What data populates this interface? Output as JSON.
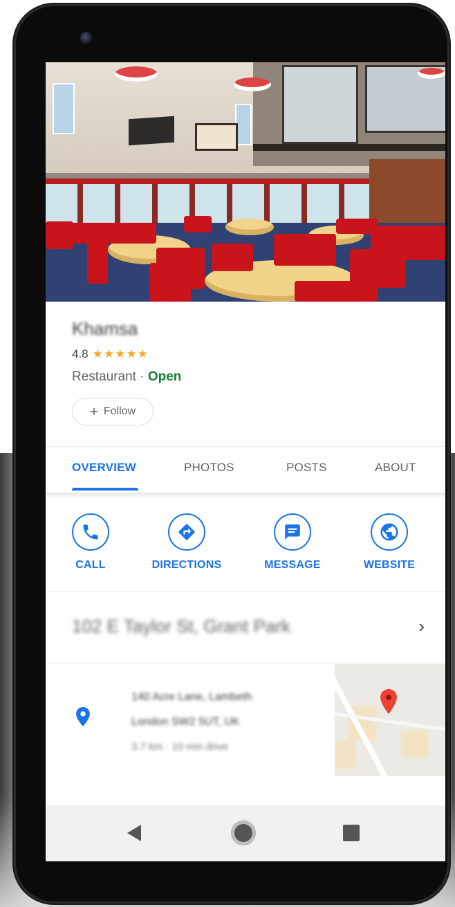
{
  "business": {
    "name": "Khamsa",
    "rating": "4.8",
    "stars": "★★★★★",
    "category": "Restaurant",
    "separator": "·",
    "status": "Open",
    "status_color": "#188038",
    "follow_label": "Follow",
    "follow_icon": "plus-icon"
  },
  "tabs": [
    {
      "label": "OVERVIEW",
      "active": true
    },
    {
      "label": "PHOTOS",
      "active": false
    },
    {
      "label": "POSTS",
      "active": false
    },
    {
      "label": "ABOUT",
      "active": false
    }
  ],
  "actions": [
    {
      "label": "CALL",
      "icon": "phone-icon"
    },
    {
      "label": "DIRECTIONS",
      "icon": "directions-icon"
    },
    {
      "label": "MESSAGE",
      "icon": "message-icon"
    },
    {
      "label": "WEBSITE",
      "icon": "globe-icon"
    }
  ],
  "address": {
    "text": "102 E Taylor St, Grant Park",
    "chevron": "›"
  },
  "location": {
    "line1": "140 Acre Lane, Lambeth",
    "line2": "London SW2 5UT, UK",
    "line3": "3.7 km · 10 min drive",
    "icon": "location-pin-icon"
  },
  "colors": {
    "accent": "#1a73e8",
    "star": "#f4a929",
    "map_pin": "#ea4335"
  },
  "navbar": {
    "back": "back-icon",
    "home": "home-icon",
    "recent": "recent-apps-icon"
  }
}
